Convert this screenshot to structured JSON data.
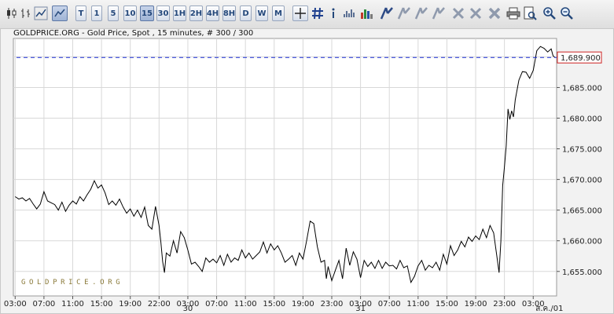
{
  "toolbar": {
    "timeframes": [
      "T",
      "1",
      "5",
      "10",
      "15",
      "30",
      "1H",
      "2H",
      "4H",
      "8H",
      "D",
      "W",
      "M"
    ],
    "selected_timeframe": "15",
    "icons": [
      "candlestick-chart-icon",
      "bar-chart-icon",
      "line-chart-icon",
      "crosshair-icon",
      "grid-icon",
      "info-icon",
      "volume-icon",
      "indicators-icon",
      "trendline-icon",
      "fibonacci-icon",
      "channel-icon",
      "arrow-tool-icon",
      "delete-tool-icon",
      "delete-all-icon",
      "print-icon",
      "print-preview-icon",
      "zoom-in-icon",
      "zoom-out-icon"
    ]
  },
  "chart_header": "GOLDPRICE.ORG - Gold Price, Spot , 15 minutes, # 300 / 300",
  "watermark": "GOLDPRICE.ORG",
  "current_price_label": "1,689.900",
  "colors": {
    "line": "#000000",
    "current_price_line": "#1c2fd6",
    "current_price_label_border": "#cc2222",
    "grid": "#d8d8d8",
    "watermark": "#8a7a3a"
  },
  "chart_data": {
    "type": "line",
    "title": "GOLDPRICE.ORG - Gold Price, Spot , 15 minutes, # 300 / 300",
    "ylabel": "",
    "xlabel": "",
    "ylim": [
      1651,
      1693
    ],
    "yticks": [
      1655,
      1660,
      1665,
      1670,
      1675,
      1680,
      1685,
      1690
    ],
    "ytick_labels": [
      "1,655.000",
      "1,660.000",
      "1,665.000",
      "1,670.000",
      "1,675.000",
      "1,680.000",
      "1,685.000",
      "1,690.000"
    ],
    "x_unit": "15-minute intervals",
    "xlim": [
      -1,
      301
    ],
    "xticks": [
      {
        "x": 0,
        "label": "03:00"
      },
      {
        "x": 16,
        "label": "07:00"
      },
      {
        "x": 32,
        "label": "11:00"
      },
      {
        "x": 48,
        "label": "15:00"
      },
      {
        "x": 64,
        "label": "19:00"
      },
      {
        "x": 80,
        "label": "22:00"
      },
      {
        "x": 96,
        "label": "03:00"
      },
      {
        "x": 112,
        "label": "07:00"
      },
      {
        "x": 128,
        "label": "11:00"
      },
      {
        "x": 144,
        "label": "15:00"
      },
      {
        "x": 160,
        "label": "19:00"
      },
      {
        "x": 176,
        "label": "23:00"
      },
      {
        "x": 192,
        "label": "03:00"
      },
      {
        "x": 208,
        "label": "07:00"
      },
      {
        "x": 224,
        "label": "11:00"
      },
      {
        "x": 240,
        "label": "15:00"
      },
      {
        "x": 256,
        "label": "19:00"
      },
      {
        "x": 272,
        "label": "23:00"
      },
      {
        "x": 288,
        "label": "03:00"
      }
    ],
    "day_labels": [
      {
        "x": 96,
        "label": "30"
      },
      {
        "x": 192,
        "label": "31"
      },
      {
        "x": 297,
        "label": "ส.ค./01"
      }
    ],
    "current_price": 1689.9,
    "grid": true,
    "series": [
      {
        "points": [
          [
            0,
            1667.2
          ],
          [
            2,
            1666.8
          ],
          [
            4,
            1667.0
          ],
          [
            6,
            1666.5
          ],
          [
            8,
            1666.9
          ],
          [
            10,
            1666.0
          ],
          [
            12,
            1665.2
          ],
          [
            14,
            1666.0
          ],
          [
            16,
            1668.0
          ],
          [
            18,
            1666.5
          ],
          [
            20,
            1666.2
          ],
          [
            22,
            1665.9
          ],
          [
            24,
            1665.0
          ],
          [
            26,
            1666.3
          ],
          [
            28,
            1664.8
          ],
          [
            30,
            1665.8
          ],
          [
            32,
            1666.5
          ],
          [
            34,
            1666.0
          ],
          [
            36,
            1667.2
          ],
          [
            38,
            1666.5
          ],
          [
            40,
            1667.5
          ],
          [
            42,
            1668.4
          ],
          [
            44,
            1669.8
          ],
          [
            46,
            1668.6
          ],
          [
            48,
            1669.1
          ],
          [
            50,
            1667.8
          ],
          [
            52,
            1665.9
          ],
          [
            54,
            1666.5
          ],
          [
            56,
            1665.8
          ],
          [
            58,
            1666.8
          ],
          [
            60,
            1665.5
          ],
          [
            62,
            1664.5
          ],
          [
            64,
            1665.2
          ],
          [
            66,
            1664.0
          ],
          [
            68,
            1665.0
          ],
          [
            70,
            1663.8
          ],
          [
            72,
            1665.5
          ],
          [
            74,
            1662.5
          ],
          [
            76,
            1661.9
          ],
          [
            78,
            1665.6
          ],
          [
            80,
            1662.5
          ],
          [
            81,
            1659.8
          ],
          [
            82,
            1656.6
          ],
          [
            83,
            1654.8
          ],
          [
            84,
            1658.0
          ],
          [
            86,
            1657.5
          ],
          [
            88,
            1660.0
          ],
          [
            90,
            1658.0
          ],
          [
            92,
            1661.5
          ],
          [
            94,
            1660.5
          ],
          [
            96,
            1658.5
          ],
          [
            98,
            1656.2
          ],
          [
            100,
            1656.5
          ],
          [
            102,
            1655.8
          ],
          [
            104,
            1655.0
          ],
          [
            106,
            1657.2
          ],
          [
            108,
            1656.5
          ],
          [
            110,
            1657.0
          ],
          [
            112,
            1656.4
          ],
          [
            114,
            1657.6
          ],
          [
            116,
            1656.0
          ],
          [
            118,
            1657.8
          ],
          [
            120,
            1656.5
          ],
          [
            122,
            1657.2
          ],
          [
            124,
            1656.8
          ],
          [
            126,
            1658.5
          ],
          [
            128,
            1657.2
          ],
          [
            130,
            1658.0
          ],
          [
            132,
            1657.0
          ],
          [
            134,
            1657.6
          ],
          [
            136,
            1658.2
          ],
          [
            138,
            1659.8
          ],
          [
            140,
            1658.0
          ],
          [
            142,
            1659.5
          ],
          [
            144,
            1658.5
          ],
          [
            146,
            1659.2
          ],
          [
            148,
            1658.0
          ],
          [
            150,
            1656.5
          ],
          [
            152,
            1657.0
          ],
          [
            154,
            1657.6
          ],
          [
            156,
            1656.0
          ],
          [
            158,
            1658.0
          ],
          [
            160,
            1657.0
          ],
          [
            162,
            1660.0
          ],
          [
            164,
            1663.2
          ],
          [
            166,
            1662.8
          ],
          [
            168,
            1659.0
          ],
          [
            170,
            1656.5
          ],
          [
            172,
            1656.8
          ],
          [
            173,
            1653.8
          ],
          [
            174,
            1655.8
          ],
          [
            176,
            1653.5
          ],
          [
            178,
            1655.2
          ],
          [
            180,
            1656.8
          ],
          [
            182,
            1653.8
          ],
          [
            184,
            1658.8
          ],
          [
            186,
            1656.0
          ],
          [
            188,
            1658.2
          ],
          [
            190,
            1657.0
          ],
          [
            192,
            1654.0
          ],
          [
            194,
            1656.8
          ],
          [
            196,
            1655.8
          ],
          [
            198,
            1656.5
          ],
          [
            200,
            1655.5
          ],
          [
            202,
            1656.8
          ],
          [
            204,
            1655.5
          ],
          [
            206,
            1656.5
          ],
          [
            208,
            1655.9
          ],
          [
            210,
            1656.0
          ],
          [
            212,
            1655.4
          ],
          [
            214,
            1656.8
          ],
          [
            216,
            1655.6
          ],
          [
            218,
            1655.9
          ],
          [
            220,
            1653.2
          ],
          [
            222,
            1654.2
          ],
          [
            224,
            1655.9
          ],
          [
            226,
            1656.8
          ],
          [
            228,
            1655.2
          ],
          [
            230,
            1656.0
          ],
          [
            232,
            1655.6
          ],
          [
            234,
            1656.5
          ],
          [
            236,
            1655.2
          ],
          [
            238,
            1657.8
          ],
          [
            240,
            1656.2
          ],
          [
            242,
            1659.2
          ],
          [
            244,
            1657.6
          ],
          [
            246,
            1658.5
          ],
          [
            248,
            1659.9
          ],
          [
            250,
            1659.0
          ],
          [
            252,
            1660.6
          ],
          [
            254,
            1659.9
          ],
          [
            256,
            1660.8
          ],
          [
            258,
            1660.2
          ],
          [
            260,
            1661.9
          ],
          [
            262,
            1660.5
          ],
          [
            264,
            1662.5
          ],
          [
            266,
            1661.3
          ],
          [
            268,
            1657.0
          ],
          [
            269,
            1654.8
          ],
          [
            270,
            1659.9
          ],
          [
            271,
            1669.0
          ],
          [
            272,
            1672.0
          ],
          [
            273,
            1675.5
          ],
          [
            274,
            1681.5
          ],
          [
            275,
            1679.8
          ],
          [
            276,
            1681.2
          ],
          [
            277,
            1680.2
          ],
          [
            278,
            1683.0
          ],
          [
            280,
            1686.2
          ],
          [
            282,
            1687.6
          ],
          [
            284,
            1687.5
          ],
          [
            286,
            1686.5
          ],
          [
            288,
            1687.8
          ],
          [
            290,
            1691.0
          ],
          [
            292,
            1691.7
          ],
          [
            294,
            1691.4
          ],
          [
            296,
            1690.8
          ],
          [
            298,
            1691.3
          ],
          [
            299,
            1690.2
          ],
          [
            300,
            1689.9
          ]
        ]
      }
    ]
  }
}
